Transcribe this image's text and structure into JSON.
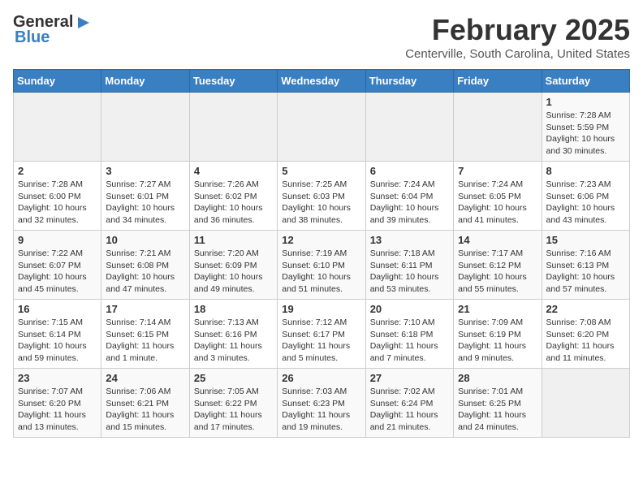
{
  "header": {
    "logo_line1": "General",
    "logo_line2": "Blue",
    "month": "February 2025",
    "location": "Centerville, South Carolina, United States"
  },
  "days_of_week": [
    "Sunday",
    "Monday",
    "Tuesday",
    "Wednesday",
    "Thursday",
    "Friday",
    "Saturday"
  ],
  "weeks": [
    [
      {
        "day": "",
        "info": ""
      },
      {
        "day": "",
        "info": ""
      },
      {
        "day": "",
        "info": ""
      },
      {
        "day": "",
        "info": ""
      },
      {
        "day": "",
        "info": ""
      },
      {
        "day": "",
        "info": ""
      },
      {
        "day": "1",
        "info": "Sunrise: 7:28 AM\nSunset: 5:59 PM\nDaylight: 10 hours and 30 minutes."
      }
    ],
    [
      {
        "day": "2",
        "info": "Sunrise: 7:28 AM\nSunset: 6:00 PM\nDaylight: 10 hours and 32 minutes."
      },
      {
        "day": "3",
        "info": "Sunrise: 7:27 AM\nSunset: 6:01 PM\nDaylight: 10 hours and 34 minutes."
      },
      {
        "day": "4",
        "info": "Sunrise: 7:26 AM\nSunset: 6:02 PM\nDaylight: 10 hours and 36 minutes."
      },
      {
        "day": "5",
        "info": "Sunrise: 7:25 AM\nSunset: 6:03 PM\nDaylight: 10 hours and 38 minutes."
      },
      {
        "day": "6",
        "info": "Sunrise: 7:24 AM\nSunset: 6:04 PM\nDaylight: 10 hours and 39 minutes."
      },
      {
        "day": "7",
        "info": "Sunrise: 7:24 AM\nSunset: 6:05 PM\nDaylight: 10 hours and 41 minutes."
      },
      {
        "day": "8",
        "info": "Sunrise: 7:23 AM\nSunset: 6:06 PM\nDaylight: 10 hours and 43 minutes."
      }
    ],
    [
      {
        "day": "9",
        "info": "Sunrise: 7:22 AM\nSunset: 6:07 PM\nDaylight: 10 hours and 45 minutes."
      },
      {
        "day": "10",
        "info": "Sunrise: 7:21 AM\nSunset: 6:08 PM\nDaylight: 10 hours and 47 minutes."
      },
      {
        "day": "11",
        "info": "Sunrise: 7:20 AM\nSunset: 6:09 PM\nDaylight: 10 hours and 49 minutes."
      },
      {
        "day": "12",
        "info": "Sunrise: 7:19 AM\nSunset: 6:10 PM\nDaylight: 10 hours and 51 minutes."
      },
      {
        "day": "13",
        "info": "Sunrise: 7:18 AM\nSunset: 6:11 PM\nDaylight: 10 hours and 53 minutes."
      },
      {
        "day": "14",
        "info": "Sunrise: 7:17 AM\nSunset: 6:12 PM\nDaylight: 10 hours and 55 minutes."
      },
      {
        "day": "15",
        "info": "Sunrise: 7:16 AM\nSunset: 6:13 PM\nDaylight: 10 hours and 57 minutes."
      }
    ],
    [
      {
        "day": "16",
        "info": "Sunrise: 7:15 AM\nSunset: 6:14 PM\nDaylight: 10 hours and 59 minutes."
      },
      {
        "day": "17",
        "info": "Sunrise: 7:14 AM\nSunset: 6:15 PM\nDaylight: 11 hours and 1 minute."
      },
      {
        "day": "18",
        "info": "Sunrise: 7:13 AM\nSunset: 6:16 PM\nDaylight: 11 hours and 3 minutes."
      },
      {
        "day": "19",
        "info": "Sunrise: 7:12 AM\nSunset: 6:17 PM\nDaylight: 11 hours and 5 minutes."
      },
      {
        "day": "20",
        "info": "Sunrise: 7:10 AM\nSunset: 6:18 PM\nDaylight: 11 hours and 7 minutes."
      },
      {
        "day": "21",
        "info": "Sunrise: 7:09 AM\nSunset: 6:19 PM\nDaylight: 11 hours and 9 minutes."
      },
      {
        "day": "22",
        "info": "Sunrise: 7:08 AM\nSunset: 6:20 PM\nDaylight: 11 hours and 11 minutes."
      }
    ],
    [
      {
        "day": "23",
        "info": "Sunrise: 7:07 AM\nSunset: 6:20 PM\nDaylight: 11 hours and 13 minutes."
      },
      {
        "day": "24",
        "info": "Sunrise: 7:06 AM\nSunset: 6:21 PM\nDaylight: 11 hours and 15 minutes."
      },
      {
        "day": "25",
        "info": "Sunrise: 7:05 AM\nSunset: 6:22 PM\nDaylight: 11 hours and 17 minutes."
      },
      {
        "day": "26",
        "info": "Sunrise: 7:03 AM\nSunset: 6:23 PM\nDaylight: 11 hours and 19 minutes."
      },
      {
        "day": "27",
        "info": "Sunrise: 7:02 AM\nSunset: 6:24 PM\nDaylight: 11 hours and 21 minutes."
      },
      {
        "day": "28",
        "info": "Sunrise: 7:01 AM\nSunset: 6:25 PM\nDaylight: 11 hours and 24 minutes."
      },
      {
        "day": "",
        "info": ""
      }
    ]
  ]
}
